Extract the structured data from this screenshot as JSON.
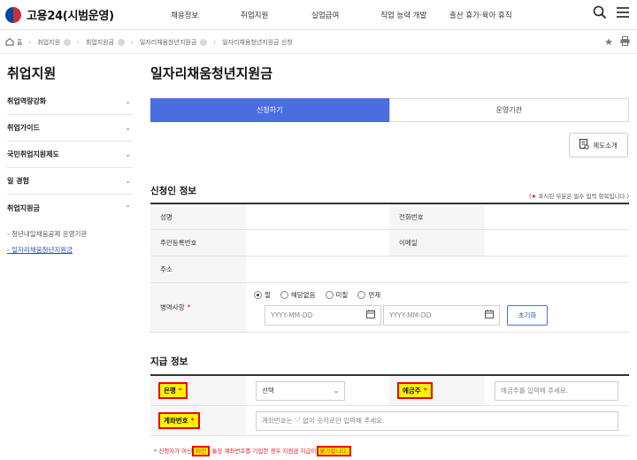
{
  "header": {
    "logo": "고용24(시범운영)",
    "nav": [
      "채용정보",
      "취업지원",
      "실업급여",
      "직업 능력 개발",
      "출산 휴가·육아 휴직"
    ],
    "icons": [
      "search-icon",
      "menu-icon"
    ]
  },
  "breadcrumb": {
    "items": [
      "홈",
      "취업지원",
      "취업지원금",
      "일자리채움청년지원금",
      "일자리채움청년지원금 신청"
    ],
    "icons": [
      "home-icon",
      "star-icon",
      "print-icon"
    ]
  },
  "sidebar": {
    "title": "취업지원",
    "items": [
      {
        "label": "취업역량강화",
        "chev": "⌄"
      },
      {
        "label": "취업가이드",
        "chev": "⌄"
      },
      {
        "label": "국민취업지원제도",
        "chev": "⌄"
      },
      {
        "label": "일 경험",
        "chev": "⌄"
      },
      {
        "label": "취업지원금",
        "chev": "⌃"
      }
    ],
    "sub": [
      "- 청년내일채움공제 운영기관",
      "- 일자리채움청년지원금"
    ]
  },
  "main": {
    "title": "일자리채움청년지원금",
    "tabs": [
      "신청하기",
      "운영기관"
    ],
    "intro_button": "제도소개"
  },
  "applicant": {
    "title": "신청인 정보",
    "required_note_star": "(★",
    "required_note": "표시된 부분은 필수 입력 항목입니다.)",
    "name_label": "성명",
    "phone_label": "전화번호",
    "rrn_label": "주민등록번호",
    "email_label": "이메일",
    "address_label": "주소",
    "military_label": "병역사항",
    "military_options": [
      "필",
      "해당없음",
      "미필",
      "면제"
    ],
    "date_placeholder": "YYYY-MM-DD",
    "reset_button": "초기화"
  },
  "payment": {
    "title": "지급 정보",
    "bank_label": "은행",
    "bank_select": "선택",
    "holder_label": "예금주",
    "holder_placeholder": "예금주를 입력해 주세요.",
    "account_label": "계좌번호",
    "account_placeholder": "계좌번호는 '-' 없이 숫자로만 입력해 주세요.",
    "note_a": "* 신청자가 아닌",
    "note_b": "타인",
    "note_c": ", 통장 계좌번호를 기입한 경우 지원금 지급이",
    "note_d": "불가합니다."
  },
  "colors": {
    "accent": "#4a6ee0",
    "required": "#e0201c",
    "highlight": "#fff200"
  }
}
